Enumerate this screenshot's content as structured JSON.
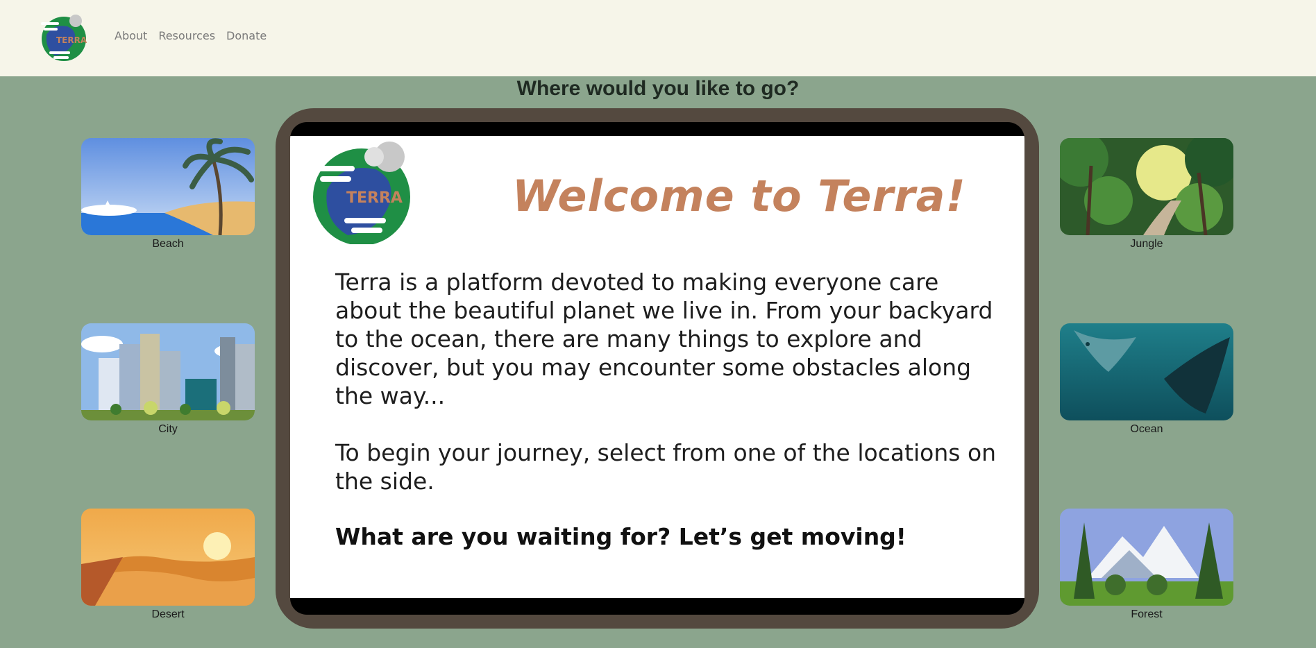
{
  "nav": {
    "logo_text": "TERRA",
    "links": [
      {
        "label": "About"
      },
      {
        "label": "Resources"
      },
      {
        "label": "Donate"
      }
    ]
  },
  "heading": "Where would you like to go?",
  "locations_left": [
    {
      "label": "Beach"
    },
    {
      "label": "City"
    },
    {
      "label": "Desert"
    }
  ],
  "locations_right": [
    {
      "label": "Jungle"
    },
    {
      "label": "Ocean"
    },
    {
      "label": "Forest"
    }
  ],
  "welcome": {
    "logo_text": "TERRA",
    "title": "Welcome to Terra!",
    "paragraph1": "Terra is a platform devoted to making everyone care about the beautiful planet we live in. From your backyard to the ocean, there are many things to explore and discover, but you may encounter some obstacles along the way...",
    "paragraph2": "To begin your journey, select from one of the locations on the side.",
    "cta": "What are you waiting for? Let’s get moving!"
  },
  "colors": {
    "page_bg": "#8ba58d",
    "navbar_bg": "#f6f5e9",
    "tablet_frame": "#54493f",
    "title_accent": "#c4825d"
  }
}
